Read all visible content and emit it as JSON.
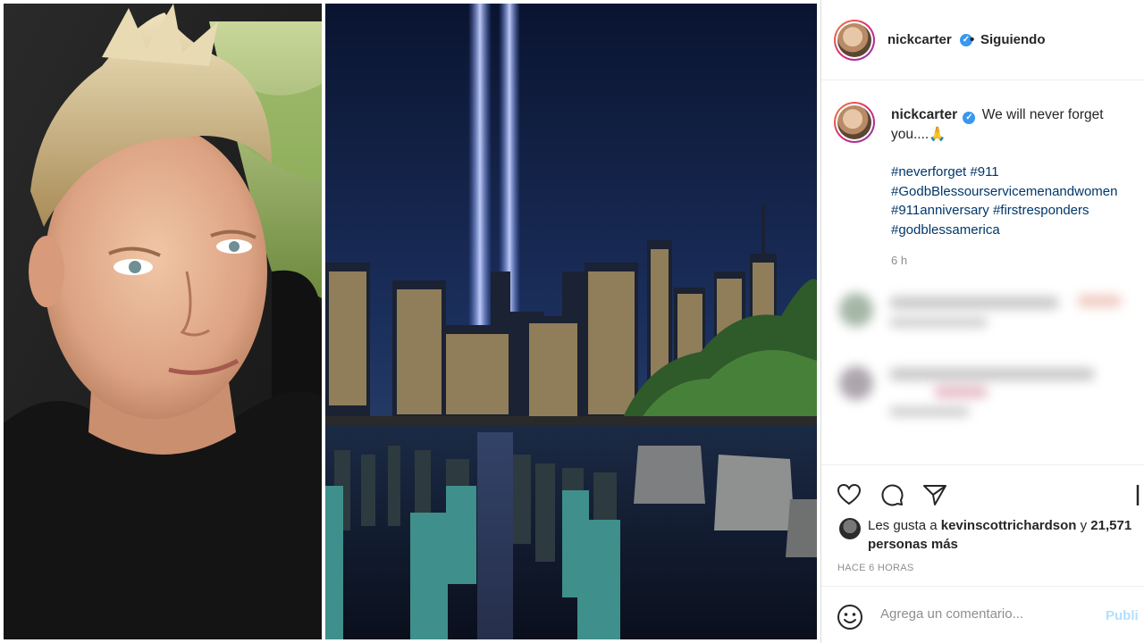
{
  "header": {
    "username": "nickcarter",
    "follow_state": "Siguiendo",
    "separator": "•"
  },
  "caption": {
    "username": "nickcarter",
    "text": "We will never forget you....🙏",
    "hashtags": [
      "#neverforget #911",
      "#GodbBlessourservicemenandwomen",
      "#911anniversary #firstresponders",
      "#godblessamerica"
    ],
    "time_ago": "6 h"
  },
  "actions": {
    "like_icon": "heart-icon",
    "comment_icon": "comment-icon",
    "share_icon": "paper-plane-icon",
    "save_icon": "bookmark-icon"
  },
  "likes": {
    "prefix": "Les gusta a",
    "user": "kevinscottrichardson",
    "connector": "y",
    "others": "21,571 personas más"
  },
  "posted_label": "HACE 6 HORAS",
  "comment_box": {
    "placeholder": "Agrega un comentario...",
    "publish_label": "Publi"
  },
  "colors": {
    "link": "#00376b",
    "verified": "#3897f0",
    "muted": "#8e8e8e",
    "publish_disabled": "#b2dffc"
  }
}
